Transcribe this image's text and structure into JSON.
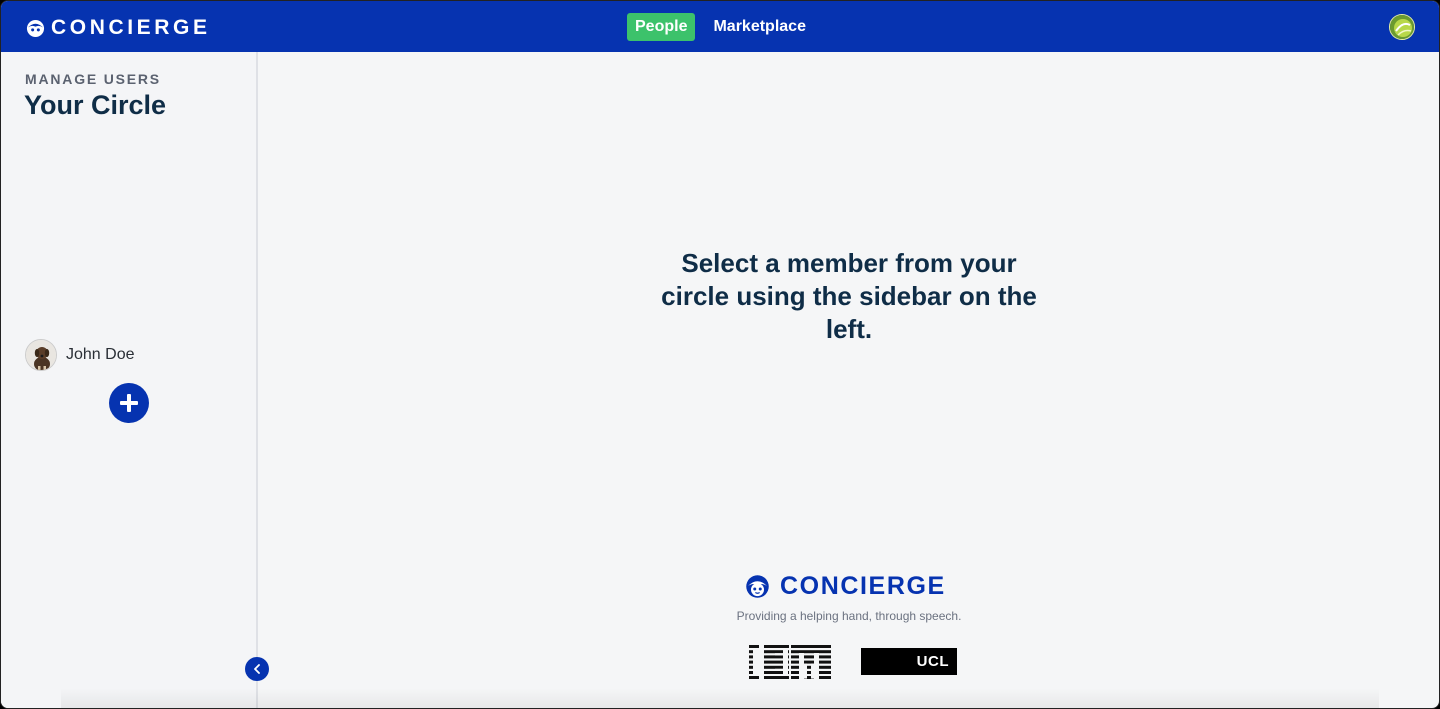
{
  "header": {
    "brand": "CONCIERGE",
    "nav": [
      {
        "label": "People",
        "active": true
      },
      {
        "label": "Marketplace",
        "active": false
      }
    ],
    "user_avatar_icon": "user-avatar-icon"
  },
  "sidebar": {
    "kicker": "MANAGE USERS",
    "title": "Your Circle",
    "members": [
      {
        "name": "John Doe"
      }
    ],
    "add_icon": "plus-icon",
    "collapse_icon": "chevron-left-icon"
  },
  "main": {
    "message": "Select a member from your circle using the sidebar on the left.",
    "footer_brand": "CONCIERGE",
    "tagline": "Providing a helping hand, through speech.",
    "partner_ucl": "UCL",
    "partner_ibm": "IBM"
  },
  "colors": {
    "primary": "#0633b0",
    "active_tab": "#3cc26b",
    "heading": "#0f2d47",
    "background": "#f5f6f7"
  }
}
